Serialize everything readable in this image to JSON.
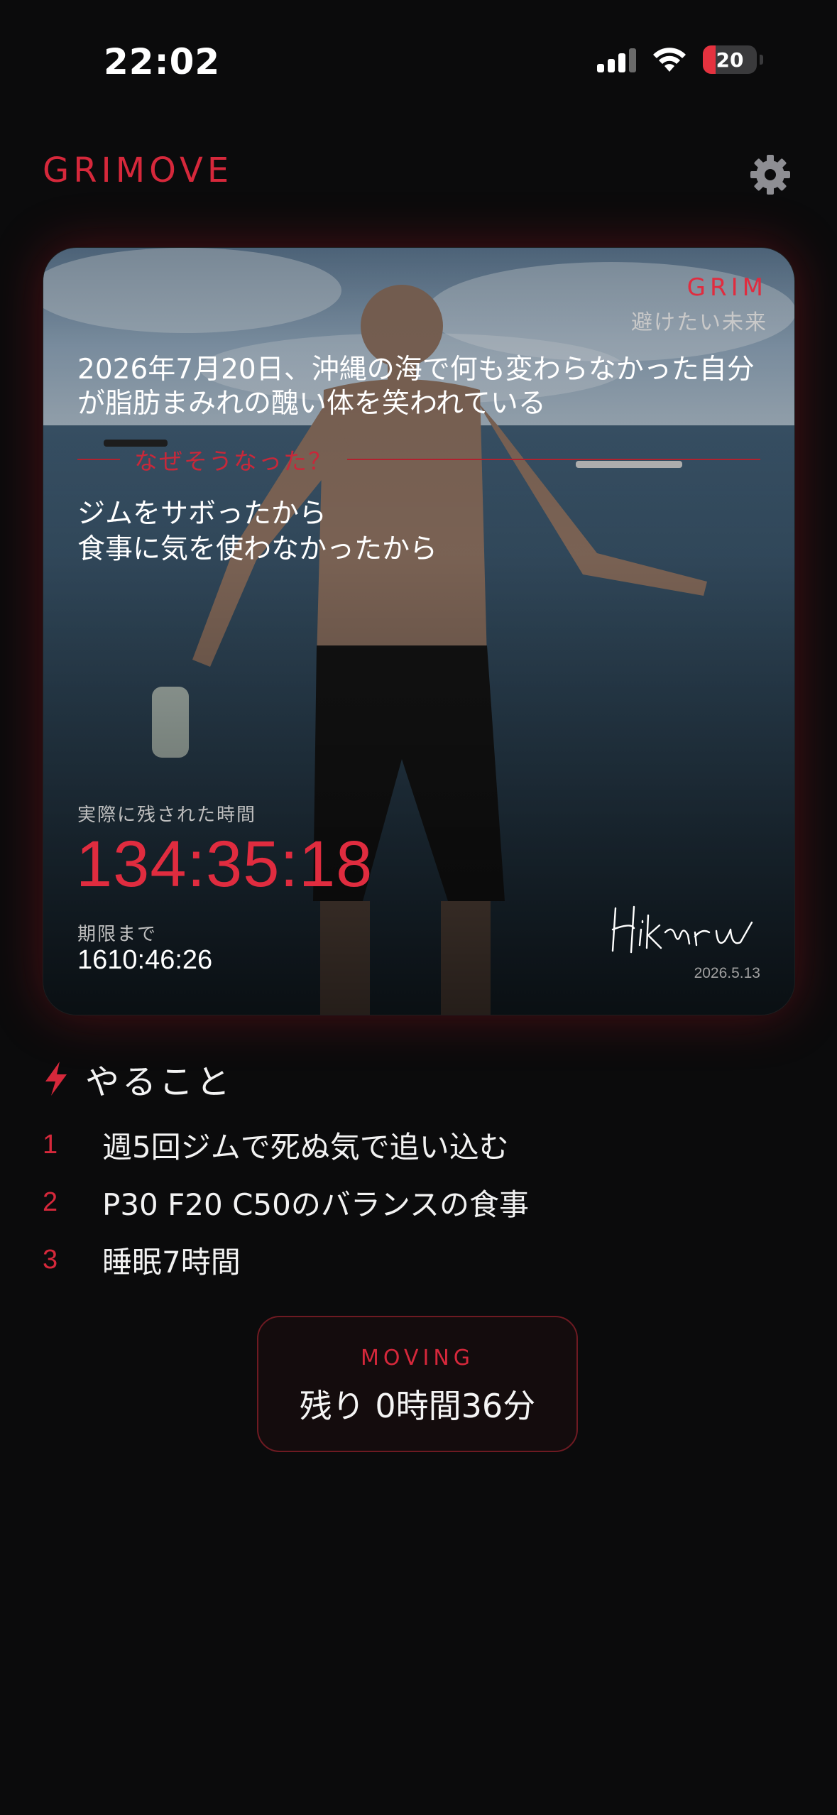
{
  "status_bar": {
    "time": "22:02",
    "battery": "20"
  },
  "header": {
    "brand": "GRIMOVE",
    "settings_icon": "gear-icon"
  },
  "card": {
    "grim_label": "GRIM",
    "grim_sub": "避けたい未来",
    "future_text": "2026年7月20日、沖縄の海で何も変わらなかった自分が脂肪まみれの醜い体を笑われている",
    "why_label": "なぜそうなった？",
    "reasons": [
      "ジムをサボったから",
      "食事に気を使わなかったから"
    ],
    "remaining_label": "実際に残された時間",
    "remaining_value": "134:35:18",
    "deadline_label": "期限まで",
    "deadline_value": "1610:46:26",
    "signature_date": "2026.5.13",
    "signature_name": "Hikaru"
  },
  "todo": {
    "title": "やること",
    "icon": "lightning-icon",
    "items": [
      {
        "num": "1",
        "text": "週5回ジムで死ぬ気で追い込む"
      },
      {
        "num": "2",
        "text": "P30 F20 C50のバランスの食事"
      },
      {
        "num": "3",
        "text": "睡眠7時間"
      }
    ]
  },
  "moving": {
    "label": "MOVING",
    "value": "残り 0時間36分"
  },
  "colors": {
    "accent": "#d6283b",
    "background": "#0b0b0c"
  }
}
